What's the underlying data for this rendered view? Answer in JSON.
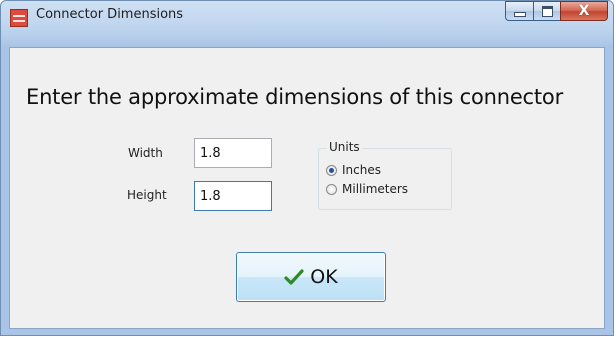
{
  "window": {
    "title": "Connector Dimensions",
    "caption_buttons": {
      "minimize_icon": "minimize-icon",
      "maximize_icon": "maximize-icon",
      "close_icon": "close-icon",
      "close_glyph": "X"
    }
  },
  "dialog": {
    "prompt": "Enter the approximate dimensions of this connector",
    "width": {
      "label": "Width",
      "value": "1.8"
    },
    "height": {
      "label": "Height",
      "value": "1.8"
    },
    "units": {
      "legend": "Units",
      "options": [
        {
          "label": "Inches",
          "selected": true
        },
        {
          "label": "Millimeters",
          "selected": false
        }
      ]
    },
    "ok": {
      "label": "OK",
      "icon": "checkmark-icon"
    }
  },
  "colors": {
    "title_bar": "#bcd3ee",
    "client_bg": "#f0f0f0",
    "close_button": "#c24530",
    "ok_border": "#3c7fb1",
    "checkmark": "#2f8a26"
  }
}
